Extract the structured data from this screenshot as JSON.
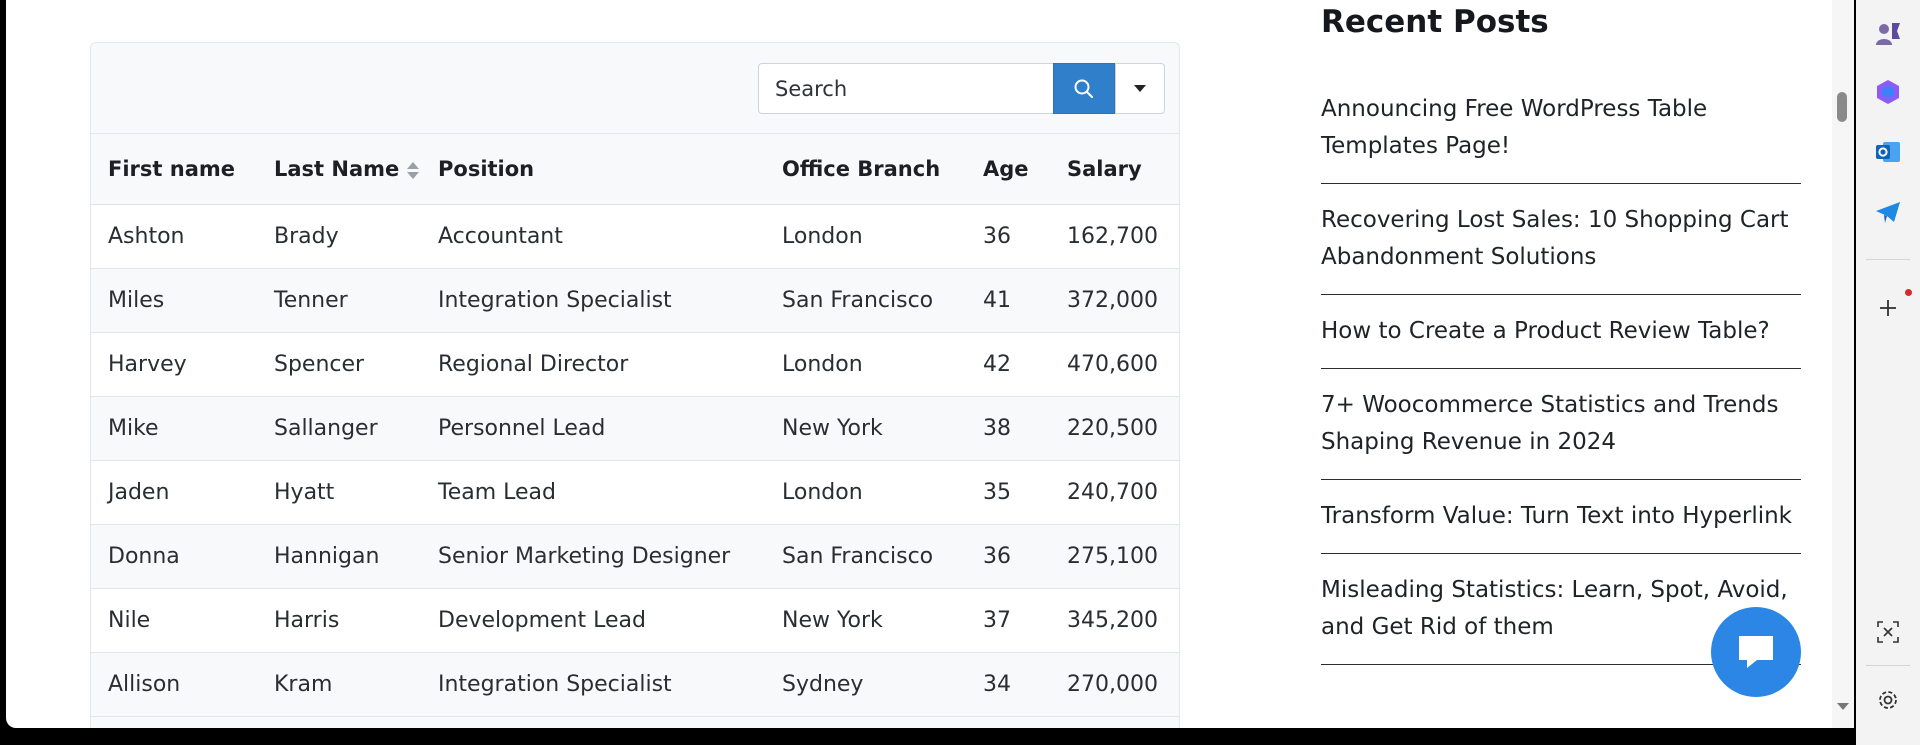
{
  "table": {
    "search": {
      "placeholder": "Search"
    },
    "headers": [
      "First name",
      "Last Name",
      "Position",
      "Office Branch",
      "Age",
      "Salary"
    ],
    "rows": [
      [
        "Ashton",
        "Brady",
        "Accountant",
        "London",
        "36",
        "162,700"
      ],
      [
        "Miles",
        "Tenner",
        "Integration Specialist",
        "San Francisco",
        "41",
        "372,000"
      ],
      [
        "Harvey",
        "Spencer",
        "Regional Director",
        "London",
        "42",
        "470,600"
      ],
      [
        "Mike",
        "Sallanger",
        "Personnel Lead",
        "New York",
        "38",
        "220,500"
      ],
      [
        "Jaden",
        "Hyatt",
        "Team Lead",
        "London",
        "35",
        "240,700"
      ],
      [
        "Donna",
        "Hannigan",
        "Senior Marketing Designer",
        "San Francisco",
        "36",
        "275,100"
      ],
      [
        "Nile",
        "Harris",
        "Development Lead",
        "New York",
        "37",
        "345,200"
      ],
      [
        "Allison",
        "Kram",
        "Integration Specialist",
        "Sydney",
        "34",
        "270,000"
      ]
    ]
  },
  "recent_posts": {
    "title": "Recent Posts",
    "items": [
      "Announcing Free WordPress Table Templates Page!",
      "Recovering Lost Sales: 10 Shopping Cart Abandonment Solutions",
      "How to Create a Product Review Table?",
      "7+ Woocommerce Statistics and Trends Shaping Revenue in 2024",
      "Transform Value: Turn Text into Hyperlink",
      "Misleading Statistics: Learn, Spot, Avoid, and Get Rid of them"
    ]
  },
  "sidebar_icons": [
    "people-icon",
    "copilot-icon",
    "outlook-icon",
    "telegram-icon",
    "add-icon",
    "screenshot-icon",
    "settings-icon"
  ],
  "colors": {
    "accent": "#2f7fcb",
    "chat": "#2b86e6"
  }
}
